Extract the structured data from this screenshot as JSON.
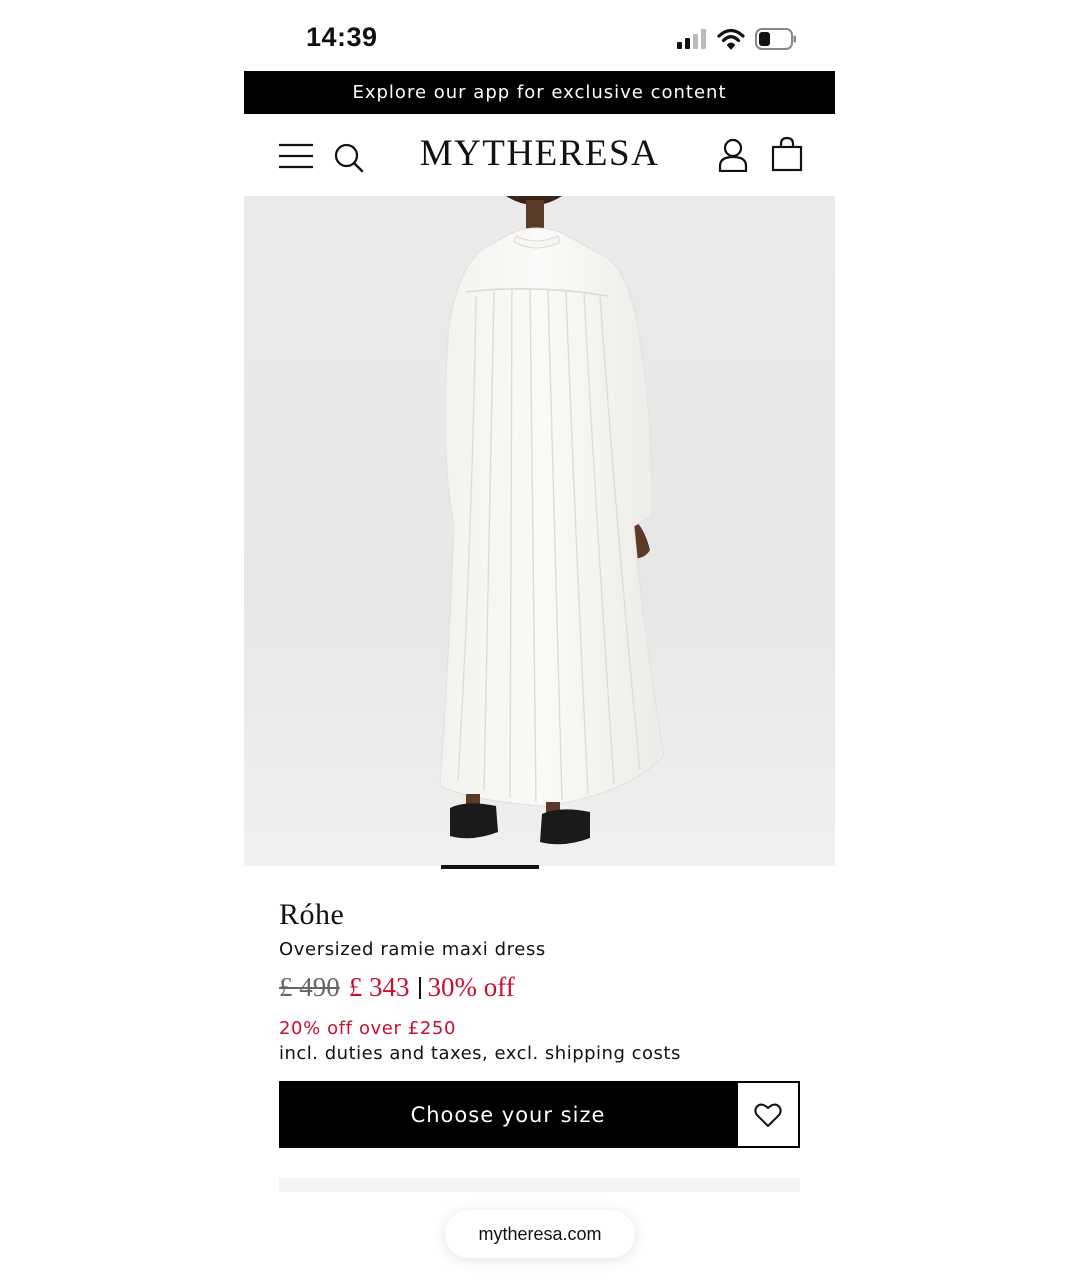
{
  "status_bar": {
    "time": "14:39",
    "icons": [
      "cellular-signal-icon",
      "wifi-icon",
      "battery-icon"
    ]
  },
  "promo_banner": {
    "text": "Explore our app for exclusive content"
  },
  "header": {
    "logo": "MYTHERESA",
    "icons": [
      "menu-icon",
      "search-icon",
      "account-icon",
      "shopping-bag-icon"
    ]
  },
  "product": {
    "brand": "Róhe",
    "name": "Oversized ramie maxi dress",
    "price_original": "£ 490",
    "price_current": "£ 343",
    "discount": "30% off",
    "promo_note": "20% off over £250",
    "tax_note": "incl. duties and taxes, excl. shipping costs",
    "cta_label": "Choose your size"
  },
  "browser": {
    "url": "mytheresa.com"
  },
  "colors": {
    "accent_red": "#c8102e",
    "black": "#000000",
    "image_bg": "#e8e8e8"
  }
}
